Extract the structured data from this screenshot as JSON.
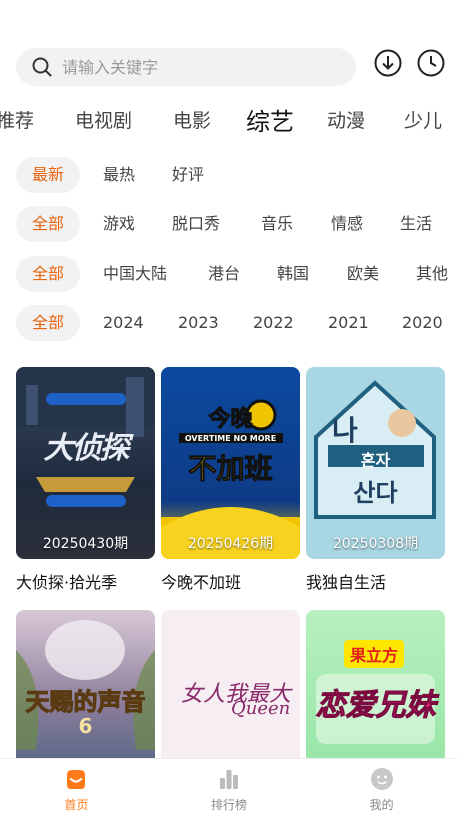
{
  "search": {
    "placeholder": "请输入关键字"
  },
  "categories": [
    "推荐",
    "电视剧",
    "电影",
    "综艺",
    "动漫",
    "少儿"
  ],
  "active_category": "综艺",
  "filters": {
    "sort": [
      "最新",
      "最热",
      "好评"
    ],
    "genre": [
      "全部",
      "游戏",
      "脱口秀",
      "音乐",
      "情感",
      "生活"
    ],
    "region": [
      "全部",
      "中国大陆",
      "港台",
      "韩国",
      "欧美",
      "其他"
    ],
    "year": [
      "全部",
      "2024",
      "2023",
      "2022",
      "2021",
      "2020"
    ]
  },
  "shows": [
    {
      "title": "大侦探·拾光季",
      "episode": "20250430期",
      "color": "#2a3a52"
    },
    {
      "title": "今晚不加班",
      "episode": "20250426期",
      "color": "#1a4a8a"
    },
    {
      "title": "我独自生活",
      "episode": "20250308期",
      "color": "#8fc7d8"
    },
    {
      "title": "",
      "episode": "",
      "color": "#c9a7b8"
    },
    {
      "title": "",
      "episode": "",
      "color": "#f4e9ee"
    },
    {
      "title": "",
      "episode": "",
      "color": "#9be0a8"
    }
  ],
  "posters": {
    "show1_text": "大侦探",
    "show2_line1": "今晚",
    "show2_line2": "不加班",
    "show2_banner": "OVERTIME NO MORE",
    "show3_line1": "나",
    "show3_line2": "혼자",
    "show3_line3": "산다",
    "show4_text": "天赐的声音",
    "show4_num": "6",
    "show5_text": "女人我最大",
    "show5_sub": "Queen",
    "show6_badge": "果立方",
    "show6_text": "恋爱兄妹"
  },
  "nav": [
    {
      "label": "首页",
      "icon": "home-icon",
      "active": true
    },
    {
      "label": "排行榜",
      "icon": "chart-icon",
      "active": false
    },
    {
      "label": "我的",
      "icon": "profile-icon",
      "active": false
    }
  ],
  "colors": {
    "accent": "#e8640c",
    "nav_active": "#ff7a1a"
  }
}
